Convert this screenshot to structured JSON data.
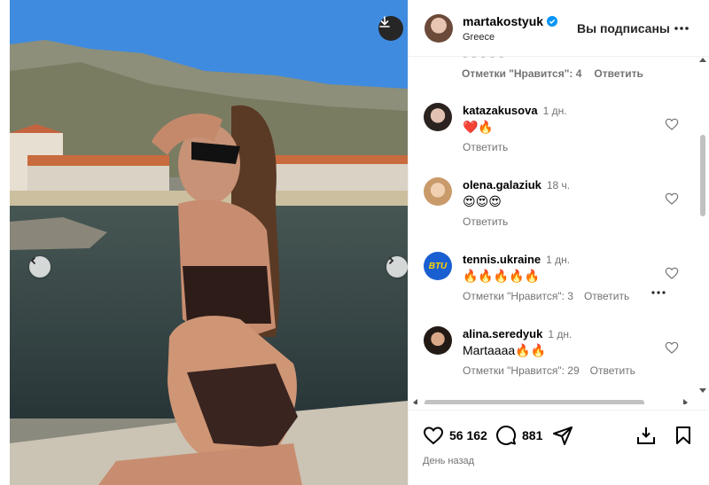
{
  "post": {
    "author": "martakostyuk",
    "location": "Greece",
    "follow_status": "Вы подписаны",
    "likes": "56 162",
    "comments_count": "881",
    "posted": "День назад"
  },
  "comments": {
    "partial": {
      "likes_label": "Отметки \"Нравится\": 4",
      "reply_label": "Ответить"
    },
    "items": [
      {
        "user": "katazakusova",
        "time": "1 дн.",
        "text": "❤️🔥",
        "likes_label": "",
        "reply_label": "Ответить"
      },
      {
        "user": "olena.galaziuk",
        "time": "18 ч.",
        "text": "😍😍😍",
        "likes_label": "",
        "reply_label": "Ответить"
      },
      {
        "user": "tennis.ukraine",
        "time": "1 дн.",
        "text": "🔥🔥🔥🔥🔥",
        "likes_label": "Отметки \"Нравится\": 3",
        "reply_label": "Ответить"
      },
      {
        "user": "alina.seredyuk",
        "time": "1 дн.",
        "text": "Martaaaa🔥🔥",
        "likes_label": "Отметки \"Нравится\": 29",
        "reply_label": "Ответить"
      }
    ]
  },
  "brand_badge": "BTU",
  "colors": {
    "verified": "#0095f6",
    "heart_red": "#ed4956",
    "badge_blue": "#1a5fd1",
    "badge_yellow": "#ffd400"
  },
  "icons": [
    "download-icon",
    "chevron-left-icon",
    "chevron-right-icon",
    "verified-icon",
    "more-icon",
    "heart-icon",
    "comment-icon",
    "share-icon",
    "save-icon"
  ]
}
